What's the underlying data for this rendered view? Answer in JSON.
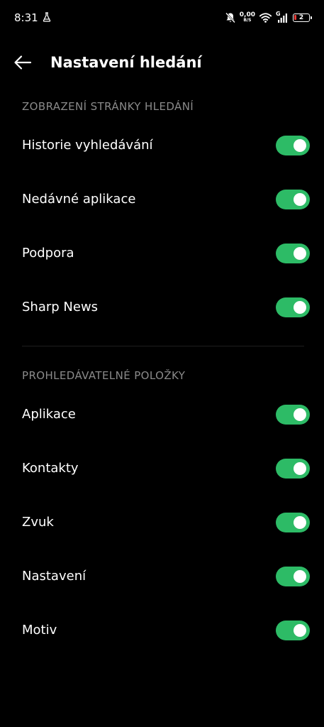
{
  "status_bar": {
    "time": "8:31",
    "net_speed_value": "0,00",
    "net_speed_unit": "B/S",
    "network_type": "G",
    "battery_level": "2",
    "icons": [
      "flask-icon",
      "mute-bell-icon",
      "wifi-icon",
      "signal-icon",
      "battery-icon"
    ]
  },
  "header": {
    "title": "Nastavení hledání"
  },
  "sections": [
    {
      "title": "ZOBRAZENÍ STRÁNKY HLEDÁNÍ",
      "items": [
        {
          "label": "Historie vyhledávání",
          "enabled": true
        },
        {
          "label": "Nedávné aplikace",
          "enabled": true
        },
        {
          "label": "Podpora",
          "enabled": true
        },
        {
          "label": "Sharp News",
          "enabled": true
        }
      ]
    },
    {
      "title": "PROHLEDÁVATELNÉ POLOŽKY",
      "items": [
        {
          "label": "Aplikace",
          "enabled": true
        },
        {
          "label": "Kontakty",
          "enabled": true
        },
        {
          "label": "Zvuk",
          "enabled": true
        },
        {
          "label": "Nastavení",
          "enabled": true
        },
        {
          "label": "Motiv",
          "enabled": true
        }
      ]
    }
  ],
  "colors": {
    "background": "#000000",
    "toggle_on": "#2dbb66",
    "section_header": "#8a8a8a",
    "battery_low": "#e53935"
  }
}
